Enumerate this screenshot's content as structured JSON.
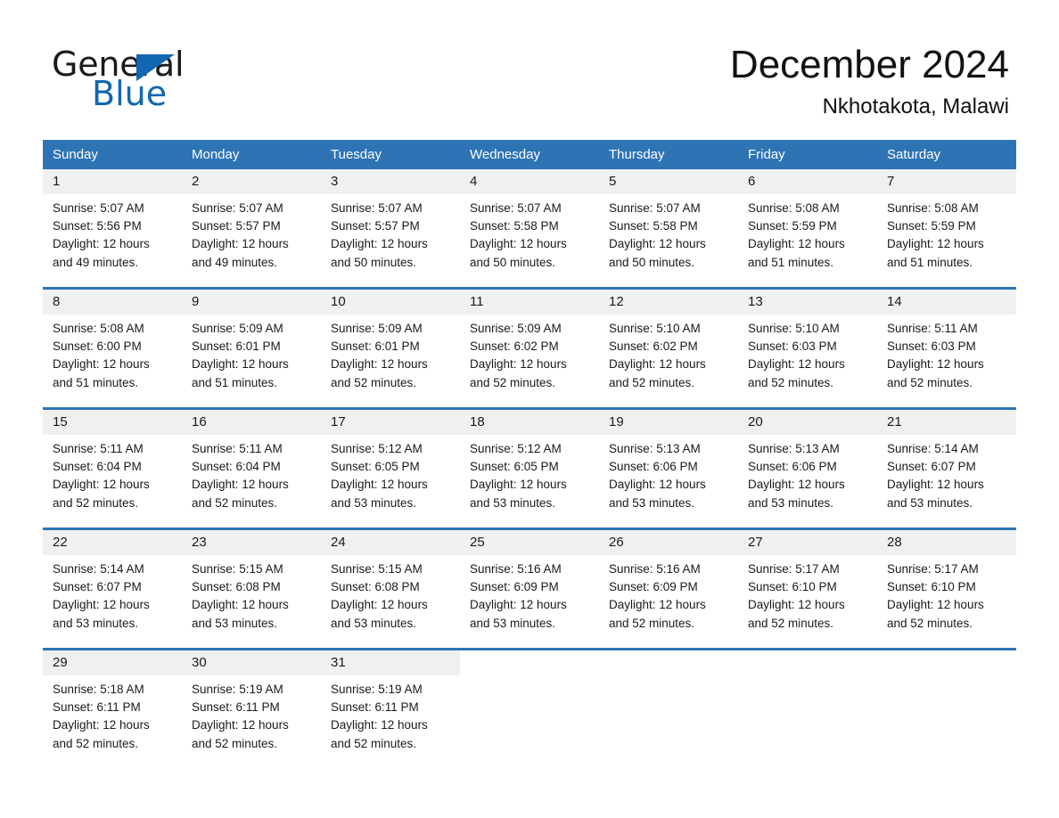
{
  "brand": {
    "name_part1": "General",
    "name_part2": "Blue",
    "accent_color": "#1167b1",
    "logo_icon": "triangle-icon"
  },
  "header": {
    "month_title": "December 2024",
    "location": "Nkhotakota, Malawi"
  },
  "calendar": {
    "header_bg": "#2e74b5",
    "day_band_bg": "#eff0f0",
    "weekdays": [
      "Sunday",
      "Monday",
      "Tuesday",
      "Wednesday",
      "Thursday",
      "Friday",
      "Saturday"
    ],
    "weeks": [
      [
        {
          "day": "1",
          "sunrise": "Sunrise: 5:07 AM",
          "sunset": "Sunset: 5:56 PM",
          "daylight_line1": "Daylight: 12 hours",
          "daylight_line2": "and 49 minutes."
        },
        {
          "day": "2",
          "sunrise": "Sunrise: 5:07 AM",
          "sunset": "Sunset: 5:57 PM",
          "daylight_line1": "Daylight: 12 hours",
          "daylight_line2": "and 49 minutes."
        },
        {
          "day": "3",
          "sunrise": "Sunrise: 5:07 AM",
          "sunset": "Sunset: 5:57 PM",
          "daylight_line1": "Daylight: 12 hours",
          "daylight_line2": "and 50 minutes."
        },
        {
          "day": "4",
          "sunrise": "Sunrise: 5:07 AM",
          "sunset": "Sunset: 5:58 PM",
          "daylight_line1": "Daylight: 12 hours",
          "daylight_line2": "and 50 minutes."
        },
        {
          "day": "5",
          "sunrise": "Sunrise: 5:07 AM",
          "sunset": "Sunset: 5:58 PM",
          "daylight_line1": "Daylight: 12 hours",
          "daylight_line2": "and 50 minutes."
        },
        {
          "day": "6",
          "sunrise": "Sunrise: 5:08 AM",
          "sunset": "Sunset: 5:59 PM",
          "daylight_line1": "Daylight: 12 hours",
          "daylight_line2": "and 51 minutes."
        },
        {
          "day": "7",
          "sunrise": "Sunrise: 5:08 AM",
          "sunset": "Sunset: 5:59 PM",
          "daylight_line1": "Daylight: 12 hours",
          "daylight_line2": "and 51 minutes."
        }
      ],
      [
        {
          "day": "8",
          "sunrise": "Sunrise: 5:08 AM",
          "sunset": "Sunset: 6:00 PM",
          "daylight_line1": "Daylight: 12 hours",
          "daylight_line2": "and 51 minutes."
        },
        {
          "day": "9",
          "sunrise": "Sunrise: 5:09 AM",
          "sunset": "Sunset: 6:01 PM",
          "daylight_line1": "Daylight: 12 hours",
          "daylight_line2": "and 51 minutes."
        },
        {
          "day": "10",
          "sunrise": "Sunrise: 5:09 AM",
          "sunset": "Sunset: 6:01 PM",
          "daylight_line1": "Daylight: 12 hours",
          "daylight_line2": "and 52 minutes."
        },
        {
          "day": "11",
          "sunrise": "Sunrise: 5:09 AM",
          "sunset": "Sunset: 6:02 PM",
          "daylight_line1": "Daylight: 12 hours",
          "daylight_line2": "and 52 minutes."
        },
        {
          "day": "12",
          "sunrise": "Sunrise: 5:10 AM",
          "sunset": "Sunset: 6:02 PM",
          "daylight_line1": "Daylight: 12 hours",
          "daylight_line2": "and 52 minutes."
        },
        {
          "day": "13",
          "sunrise": "Sunrise: 5:10 AM",
          "sunset": "Sunset: 6:03 PM",
          "daylight_line1": "Daylight: 12 hours",
          "daylight_line2": "and 52 minutes."
        },
        {
          "day": "14",
          "sunrise": "Sunrise: 5:11 AM",
          "sunset": "Sunset: 6:03 PM",
          "daylight_line1": "Daylight: 12 hours",
          "daylight_line2": "and 52 minutes."
        }
      ],
      [
        {
          "day": "15",
          "sunrise": "Sunrise: 5:11 AM",
          "sunset": "Sunset: 6:04 PM",
          "daylight_line1": "Daylight: 12 hours",
          "daylight_line2": "and 52 minutes."
        },
        {
          "day": "16",
          "sunrise": "Sunrise: 5:11 AM",
          "sunset": "Sunset: 6:04 PM",
          "daylight_line1": "Daylight: 12 hours",
          "daylight_line2": "and 52 minutes."
        },
        {
          "day": "17",
          "sunrise": "Sunrise: 5:12 AM",
          "sunset": "Sunset: 6:05 PM",
          "daylight_line1": "Daylight: 12 hours",
          "daylight_line2": "and 53 minutes."
        },
        {
          "day": "18",
          "sunrise": "Sunrise: 5:12 AM",
          "sunset": "Sunset: 6:05 PM",
          "daylight_line1": "Daylight: 12 hours",
          "daylight_line2": "and 53 minutes."
        },
        {
          "day": "19",
          "sunrise": "Sunrise: 5:13 AM",
          "sunset": "Sunset: 6:06 PM",
          "daylight_line1": "Daylight: 12 hours",
          "daylight_line2": "and 53 minutes."
        },
        {
          "day": "20",
          "sunrise": "Sunrise: 5:13 AM",
          "sunset": "Sunset: 6:06 PM",
          "daylight_line1": "Daylight: 12 hours",
          "daylight_line2": "and 53 minutes."
        },
        {
          "day": "21",
          "sunrise": "Sunrise: 5:14 AM",
          "sunset": "Sunset: 6:07 PM",
          "daylight_line1": "Daylight: 12 hours",
          "daylight_line2": "and 53 minutes."
        }
      ],
      [
        {
          "day": "22",
          "sunrise": "Sunrise: 5:14 AM",
          "sunset": "Sunset: 6:07 PM",
          "daylight_line1": "Daylight: 12 hours",
          "daylight_line2": "and 53 minutes."
        },
        {
          "day": "23",
          "sunrise": "Sunrise: 5:15 AM",
          "sunset": "Sunset: 6:08 PM",
          "daylight_line1": "Daylight: 12 hours",
          "daylight_line2": "and 53 minutes."
        },
        {
          "day": "24",
          "sunrise": "Sunrise: 5:15 AM",
          "sunset": "Sunset: 6:08 PM",
          "daylight_line1": "Daylight: 12 hours",
          "daylight_line2": "and 53 minutes."
        },
        {
          "day": "25",
          "sunrise": "Sunrise: 5:16 AM",
          "sunset": "Sunset: 6:09 PM",
          "daylight_line1": "Daylight: 12 hours",
          "daylight_line2": "and 53 minutes."
        },
        {
          "day": "26",
          "sunrise": "Sunrise: 5:16 AM",
          "sunset": "Sunset: 6:09 PM",
          "daylight_line1": "Daylight: 12 hours",
          "daylight_line2": "and 52 minutes."
        },
        {
          "day": "27",
          "sunrise": "Sunrise: 5:17 AM",
          "sunset": "Sunset: 6:10 PM",
          "daylight_line1": "Daylight: 12 hours",
          "daylight_line2": "and 52 minutes."
        },
        {
          "day": "28",
          "sunrise": "Sunrise: 5:17 AM",
          "sunset": "Sunset: 6:10 PM",
          "daylight_line1": "Daylight: 12 hours",
          "daylight_line2": "and 52 minutes."
        }
      ],
      [
        {
          "day": "29",
          "sunrise": "Sunrise: 5:18 AM",
          "sunset": "Sunset: 6:11 PM",
          "daylight_line1": "Daylight: 12 hours",
          "daylight_line2": "and 52 minutes."
        },
        {
          "day": "30",
          "sunrise": "Sunrise: 5:19 AM",
          "sunset": "Sunset: 6:11 PM",
          "daylight_line1": "Daylight: 12 hours",
          "daylight_line2": "and 52 minutes."
        },
        {
          "day": "31",
          "sunrise": "Sunrise: 5:19 AM",
          "sunset": "Sunset: 6:11 PM",
          "daylight_line1": "Daylight: 12 hours",
          "daylight_line2": "and 52 minutes."
        },
        {
          "day": "",
          "sunrise": "",
          "sunset": "",
          "daylight_line1": "",
          "daylight_line2": ""
        },
        {
          "day": "",
          "sunrise": "",
          "sunset": "",
          "daylight_line1": "",
          "daylight_line2": ""
        },
        {
          "day": "",
          "sunrise": "",
          "sunset": "",
          "daylight_line1": "",
          "daylight_line2": ""
        },
        {
          "day": "",
          "sunrise": "",
          "sunset": "",
          "daylight_line1": "",
          "daylight_line2": ""
        }
      ]
    ]
  }
}
